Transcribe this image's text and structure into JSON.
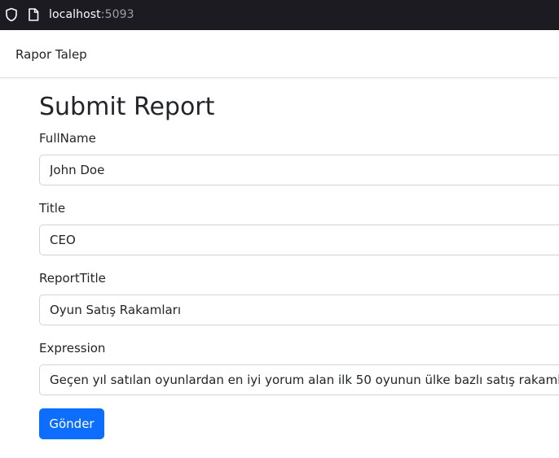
{
  "browser": {
    "url_host": "localhost",
    "url_port": ":5093",
    "icons": [
      "shield-icon",
      "page-icon"
    ]
  },
  "navbar": {
    "brand": "Rapor Talep"
  },
  "form": {
    "title": "Submit Report",
    "fields": [
      {
        "label": "FullName",
        "value": "John Doe"
      },
      {
        "label": "Title",
        "value": "CEO"
      },
      {
        "label": "ReportTitle",
        "value": "Oyun Satış Rakamları"
      },
      {
        "label": "Expression",
        "value": "Geçen yıl satılan oyunlardan en iyi yorum alan ilk 50 oyunun ülke bazlı satış rakamları."
      }
    ],
    "submit_label": "Gönder"
  },
  "colors": {
    "browser_bar": "#1c1b22",
    "primary": "#0d6efd",
    "input_border": "#ced4da"
  }
}
